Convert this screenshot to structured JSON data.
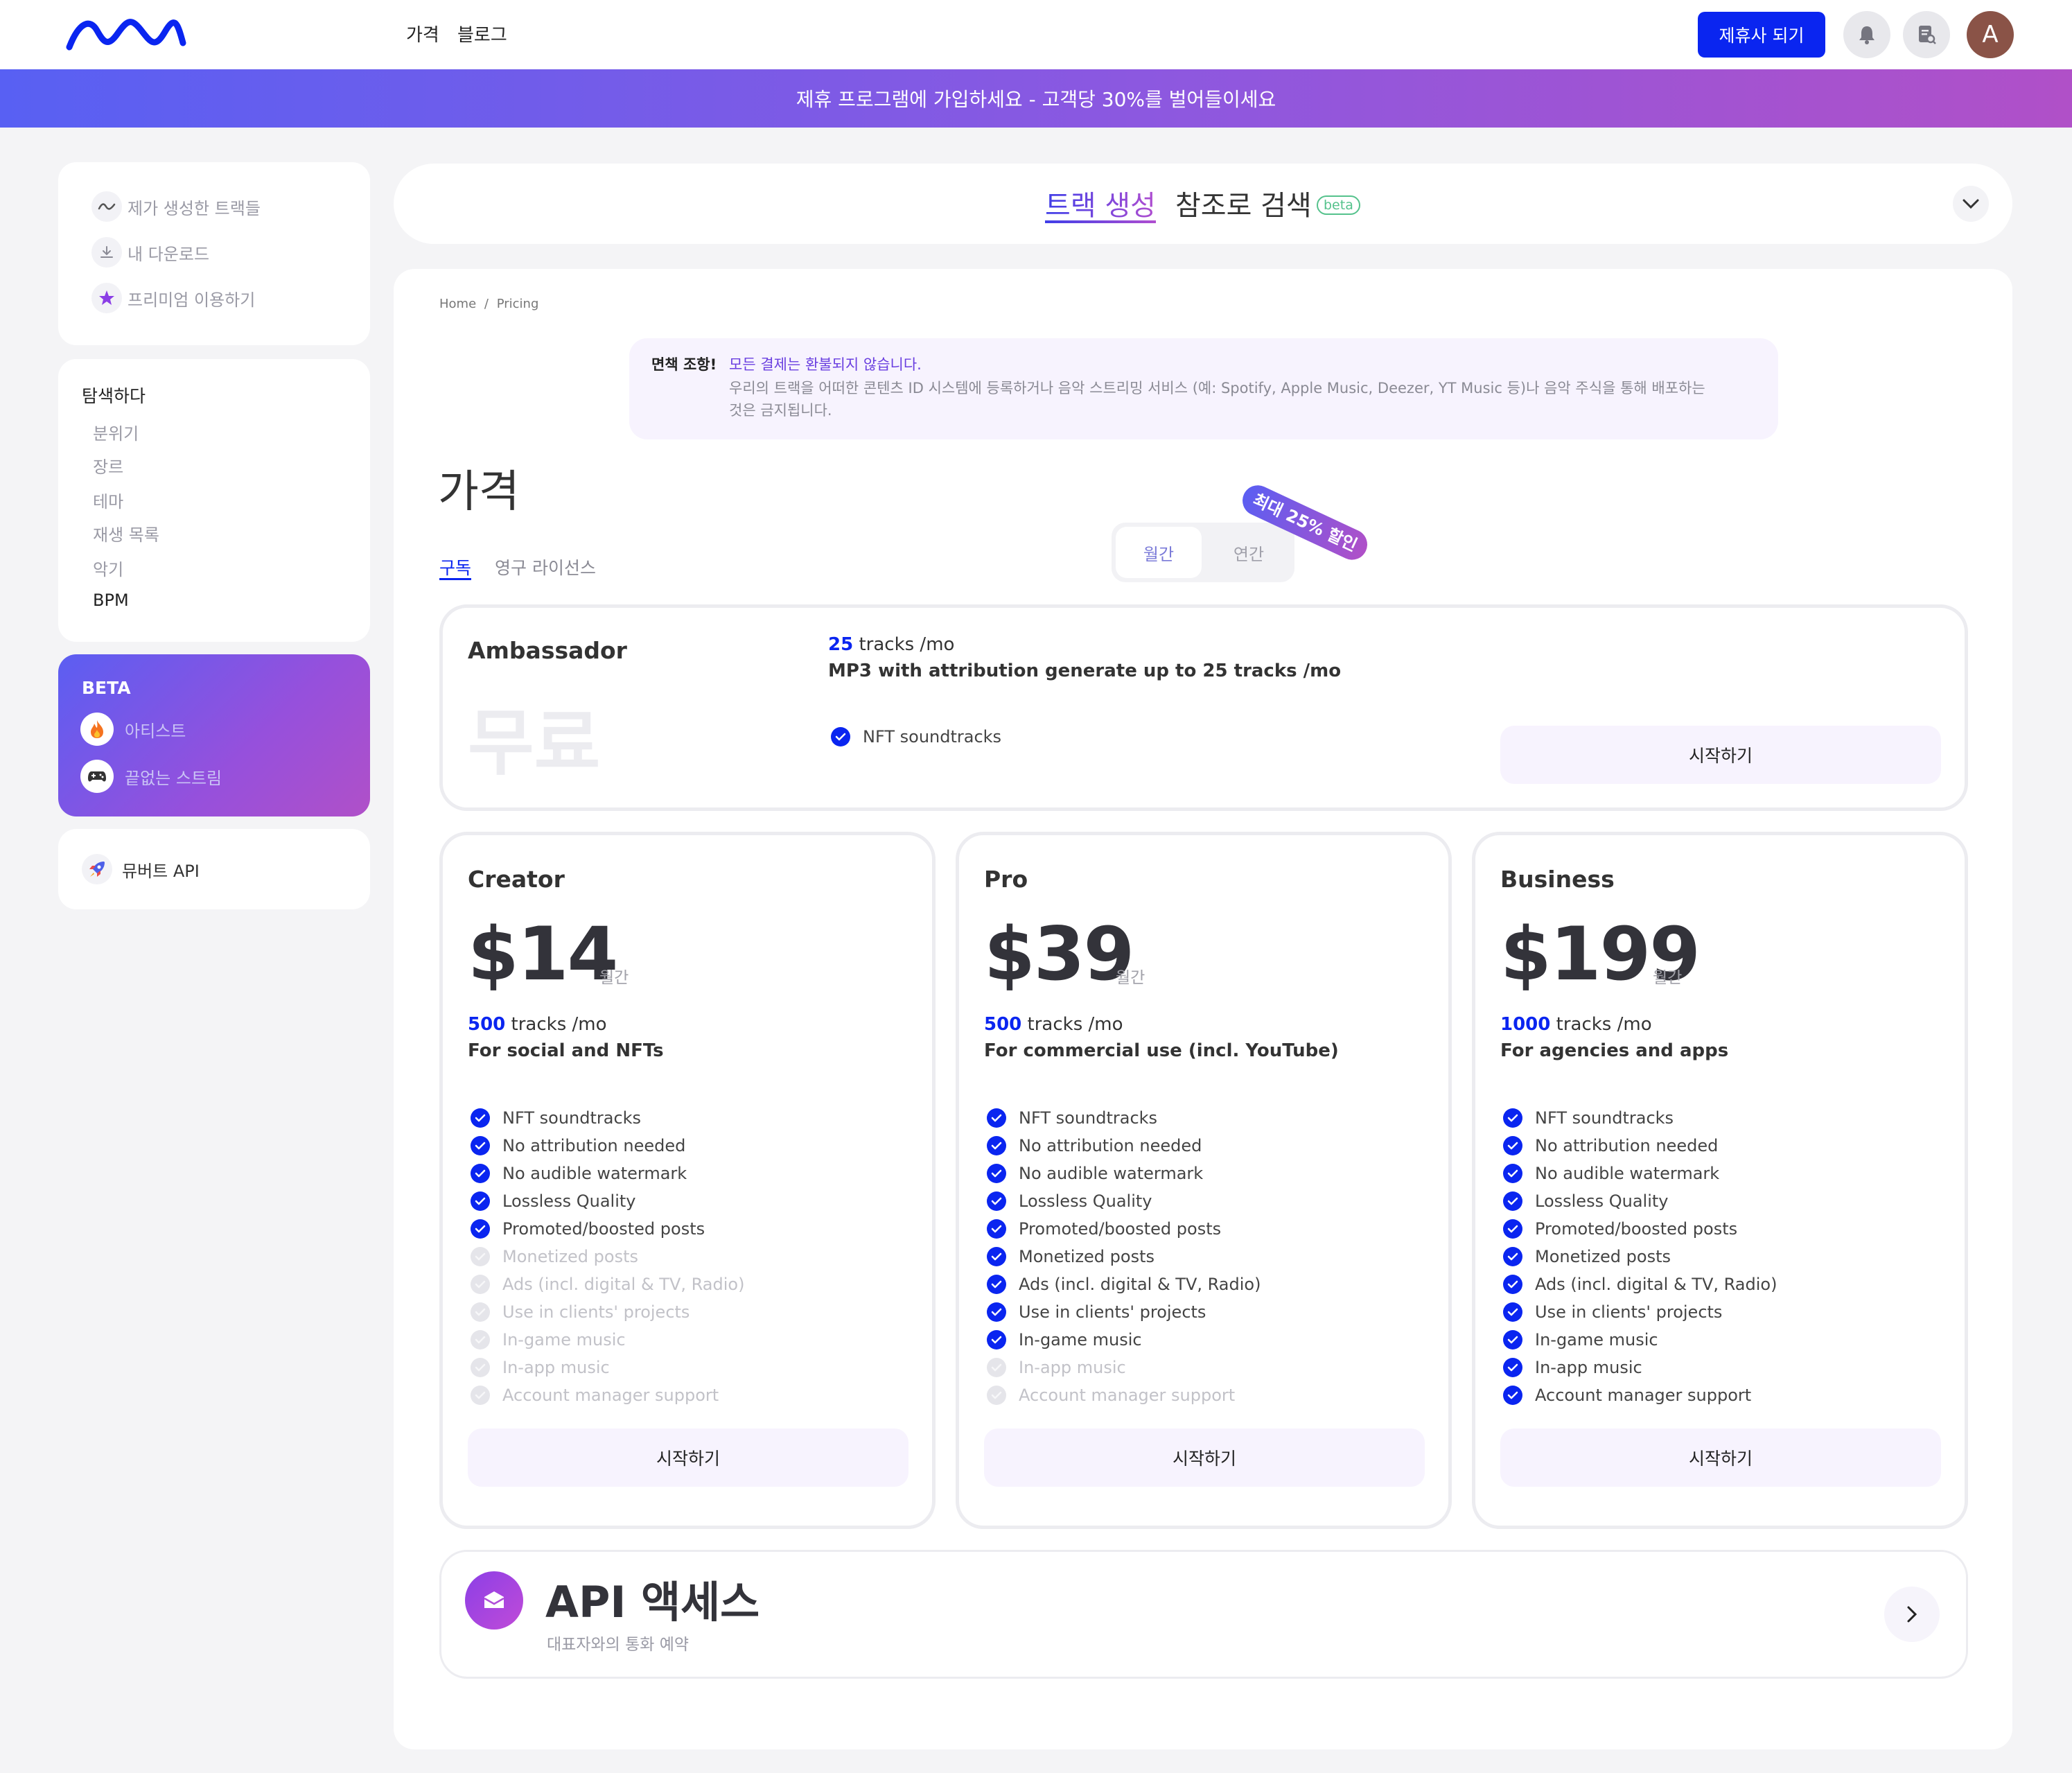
{
  "nav": {
    "pricing": "가격",
    "blog": "블로그",
    "partner_button": "제휴사 되기",
    "avatar_letter": "A"
  },
  "banner": {
    "text": "제휴 프로그램에 가입하세요 - 고객당 30%를 벌어들이세요"
  },
  "sidebar": {
    "user_items": [
      {
        "label": "제가 생성한 트랙들",
        "icon": "wave-icon"
      },
      {
        "label": "내 다운로드",
        "icon": "download-icon"
      },
      {
        "label": "프리미엄 이용하기",
        "icon": "star-icon"
      }
    ],
    "explore": {
      "title": "탐색하다",
      "items": [
        "분위기",
        "장르",
        "테마",
        "재생 목록",
        "악기",
        "BPM"
      ]
    },
    "beta": {
      "title": "BETA",
      "items": [
        {
          "label": "아티스트",
          "icon": "fire-icon"
        },
        {
          "label": "끝없는 스트림",
          "icon": "gamepad-icon"
        }
      ]
    },
    "api": {
      "label": "뮤버트 API",
      "icon": "rocket-icon"
    }
  },
  "top_tabs": {
    "generate": "트랙 생성",
    "search": "참조로 검색",
    "beta_badge": "beta"
  },
  "breadcrumb": {
    "home": "Home",
    "sep": "/",
    "current": "Pricing"
  },
  "disclaimer": {
    "label": "면책 조항!",
    "highlight": "모든 결제는 환불되지 않습니다.",
    "body_line1": "우리의 트랙을 어떠한 콘텐츠 ID 시스템에 등록하거나 음악 스트리밍 서비스 (예: Spotify, Apple Music, Deezer, YT Music 등)나 음악 주식을 통해 배포하는",
    "body_line2": "것은 금지됩니다."
  },
  "page_title": "가격",
  "license_tabs": {
    "subscription": "구독",
    "perpetual": "영구 라이선스"
  },
  "billing_toggle": {
    "monthly": "월간",
    "yearly": "연간",
    "discount_badge": "최대 25% 할인"
  },
  "ambassador": {
    "name": "Ambassador",
    "price": "무료",
    "tracks_count": "25",
    "tracks_unit": "tracks /mo",
    "tagline": "MP3 with attribution generate up to 25 tracks /mo",
    "feature": "NFT soundtracks",
    "button": "시작하기"
  },
  "feature_labels": [
    "NFT soundtracks",
    "No attribution needed",
    "No audible watermark",
    "Lossless Quality",
    "Promoted/boosted posts",
    "Monetized posts",
    "Ads (incl. digital & TV, Radio)",
    "Use in clients' projects",
    "In-game music",
    "In-app music",
    "Account manager support"
  ],
  "plans": [
    {
      "name": "Creator",
      "price": "$14",
      "unit": "월간",
      "tracks_count": "500",
      "tracks_unit": "tracks /mo",
      "tagline": "For social and NFTs",
      "included": [
        true,
        true,
        true,
        true,
        true,
        false,
        false,
        false,
        false,
        false,
        false
      ],
      "button": "시작하기"
    },
    {
      "name": "Pro",
      "price": "$39",
      "unit": "월간",
      "tracks_count": "500",
      "tracks_unit": "tracks /mo",
      "tagline": "For commercial use (incl. YouTube)",
      "included": [
        true,
        true,
        true,
        true,
        true,
        true,
        true,
        true,
        true,
        false,
        false
      ],
      "button": "시작하기"
    },
    {
      "name": "Business",
      "price": "$199",
      "unit": "월간",
      "tracks_count": "1000",
      "tracks_unit": "tracks /mo",
      "tagline": "For agencies and apps",
      "included": [
        true,
        true,
        true,
        true,
        true,
        true,
        true,
        true,
        true,
        true,
        true
      ],
      "button": "시작하기"
    }
  ],
  "api_access": {
    "title": "API 액세스",
    "subtitle": "대표자와의 통화 예약",
    "icon": "mail-icon"
  },
  "colors": {
    "accent_blue": "#0a25f0",
    "banner_start": "#5860f3",
    "banner_end": "#b050c8",
    "button_bg": "#f7f3fe"
  }
}
